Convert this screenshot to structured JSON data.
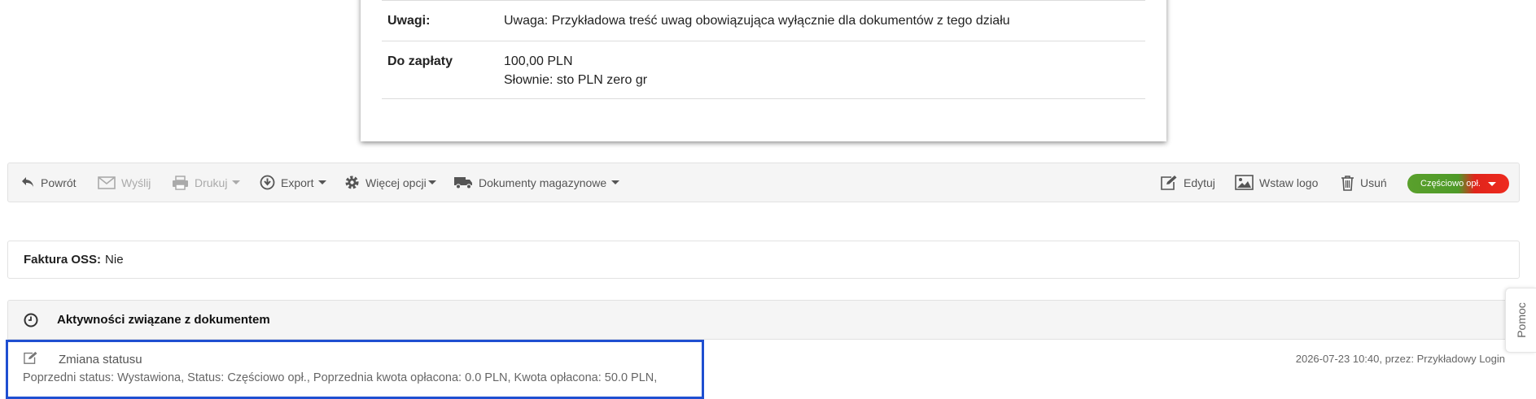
{
  "invoice": {
    "remarks_label": "Uwagi:",
    "remarks_value": "Uwaga: Przykładowa treść uwag obowiązująca wyłącznie dla dokumentów z tego działu",
    "payable_label": "Do zapłaty",
    "payable_amount": "100,00 PLN",
    "payable_words": "Słownie: sto PLN zero gr"
  },
  "toolbar": {
    "back": "Powrót",
    "send": "Wyślij",
    "print": "Drukuj",
    "export": "Export",
    "more": "Więcej opcji",
    "warehouse": "Dokumenty magazynowe",
    "edit": "Edytuj",
    "logo": "Wstaw logo",
    "delete": "Usuń",
    "status": "Częściowo opł."
  },
  "oss": {
    "label": "Faktura OSS:",
    "value": "Nie"
  },
  "activities": {
    "title": "Aktywności związane z dokumentem",
    "items": [
      {
        "title": "Zmiana statusu",
        "description": "Poprzedni status: Wystawiona, Status: Częściowo opł., Poprzednia kwota opłacona: 0.0 PLN, Kwota opłacona: 50.0 PLN,",
        "meta": "2026-07-23 10:40, przez: Przykładowy Login"
      }
    ]
  },
  "help": {
    "label": "Pomoc"
  },
  "colors": {
    "highlight": "#1f4fd1",
    "status_paid": "#4e9a28",
    "status_unpaid": "#e0251b"
  },
  "icons": {
    "back": "reply-arrow-icon",
    "send": "envelope-icon",
    "print": "printer-icon",
    "export": "download-circle-icon",
    "more": "gear-icon",
    "warehouse": "truck-icon",
    "edit": "edit-icon",
    "logo": "image-icon",
    "delete": "trash-icon",
    "activities": "clock-icon",
    "activity_item": "edit-icon"
  }
}
